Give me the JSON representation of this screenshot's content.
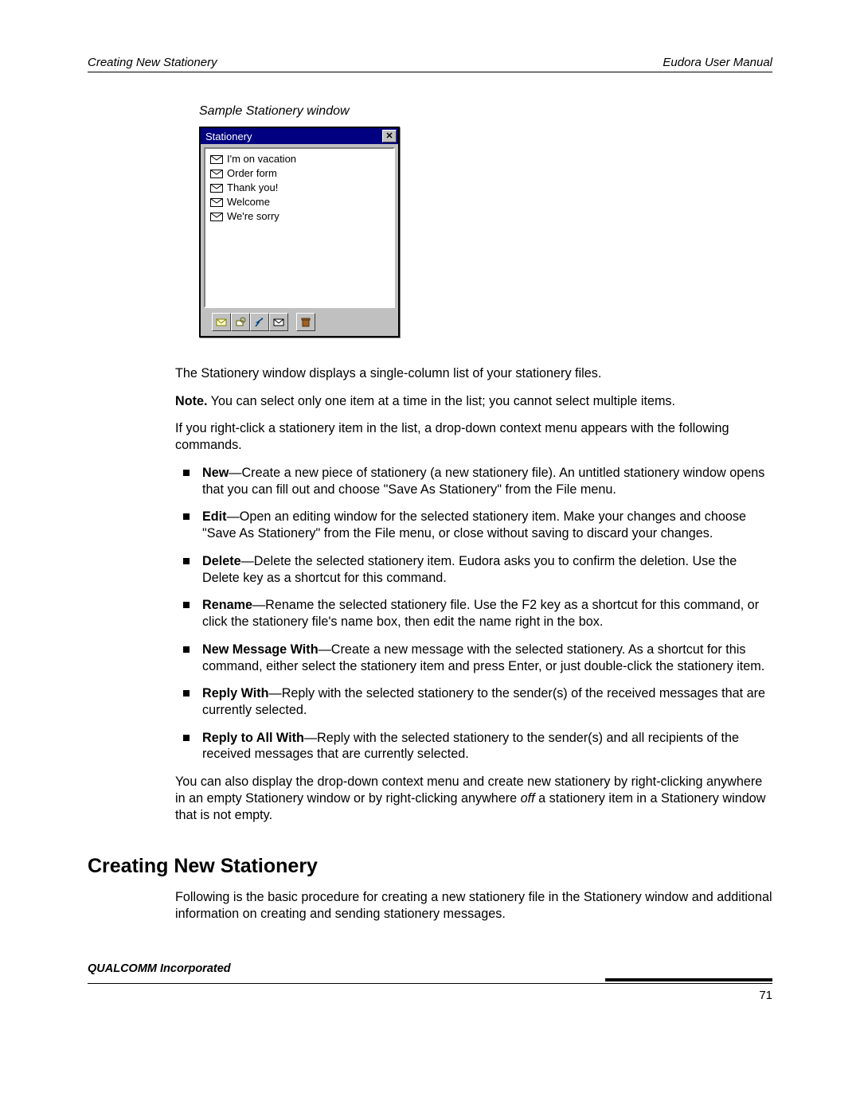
{
  "header": {
    "left": "Creating New Stationery",
    "right": "Eudora User Manual"
  },
  "caption": "Sample Stationery window",
  "window": {
    "title": "Stationery",
    "items": [
      "I'm on vacation",
      "Order form",
      "Thank you!",
      "Welcome",
      "We're sorry"
    ],
    "toolbar_icons": [
      "new-message-icon",
      "edit-icon",
      "reply-icon",
      "new-stationery-icon",
      "delete-icon"
    ]
  },
  "para1": "The Stationery window displays a single-column list of your stationery files.",
  "note_label": "Note.",
  "note_text": " You can select only one item at a time in the list; you cannot select multiple items.",
  "para2": "If you right-click a stationery item in the list, a drop-down context menu appears with the following commands.",
  "bullets": [
    {
      "term": "New",
      "text": "—Create a new piece of stationery (a new stationery file). An untitled stationery window opens that you can fill out and choose \"Save As Stationery\" from the File menu."
    },
    {
      "term": "Edit",
      "text": "—Open an editing window for the selected stationery item. Make your changes and choose \"Save As Stationery\" from the File menu, or close without saving to discard your changes."
    },
    {
      "term": "Delete",
      "text": "—Delete the selected stationery item. Eudora asks you to confirm the deletion. Use the Delete key as a shortcut for this command."
    },
    {
      "term": "Rename",
      "text": "—Rename the selected stationery file. Use the F2 key as a shortcut for this command, or click the stationery file's name box, then edit the name right in the box."
    },
    {
      "term": "New Message With",
      "text": "—Create a new message with the selected stationery. As a shortcut for this command, either select the stationery item and press Enter, or just double-click the stationery item."
    },
    {
      "term": "Reply With",
      "text": "—Reply with the selected stationery to the sender(s) of the received messages that are currently selected."
    },
    {
      "term": "Reply to All With",
      "text": "—Reply with the selected stationery to the sender(s) and all recipients of the received messages that are currently selected."
    }
  ],
  "para3_pre": "You can also display the drop-down context menu and create new stationery by right-clicking anywhere in an empty Stationery window or by right-clicking anywhere ",
  "para3_em": "off",
  "para3_post": " a stationery item in a Stationery window that is not empty.",
  "section_heading": "Creating New Stationery",
  "para4": "Following is the basic procedure for creating a new stationery file in the Stationery window and additional information on creating and sending stationery messages.",
  "footer": {
    "left": "QUALCOMM Incorporated",
    "page": "71"
  }
}
